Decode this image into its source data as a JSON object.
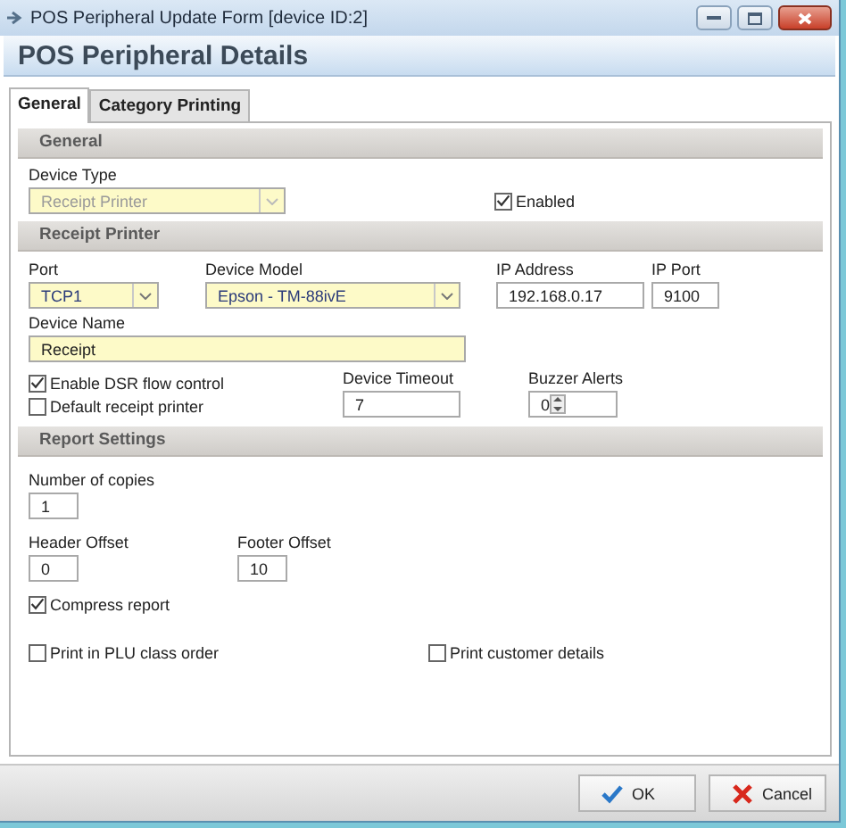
{
  "window": {
    "title": "POS Peripheral Update Form  [device ID:2]"
  },
  "header": "POS Peripheral Details",
  "tabs": [
    {
      "label": "General",
      "selected": true
    },
    {
      "label": "Category Printing",
      "selected": false
    }
  ],
  "general": {
    "title": "General",
    "device_type": {
      "label": "Device Type",
      "value": "Receipt Printer",
      "disabled": true
    },
    "enabled": {
      "label": "Enabled",
      "checked": true
    }
  },
  "receipt_printer": {
    "title": "Receipt Printer",
    "port": {
      "label": "Port",
      "value": "TCP1"
    },
    "device_model": {
      "label": "Device Model",
      "value": "Epson - TM-88ivE"
    },
    "ip_address": {
      "label": "IP Address",
      "value": "192.168.0.17"
    },
    "ip_port": {
      "label": "IP Port",
      "value": "9100"
    },
    "device_name": {
      "label": "Device Name",
      "value": "Receipt"
    },
    "dsr_flow_control": {
      "label": "Enable DSR flow control",
      "checked": true
    },
    "default_printer": {
      "label": "Default receipt printer",
      "checked": false
    },
    "device_timeout": {
      "label": "Device Timeout",
      "value": "7"
    },
    "buzzer_alerts": {
      "label": "Buzzer Alerts",
      "value": "0"
    }
  },
  "report_settings": {
    "title": "Report Settings",
    "copies": {
      "label": "Number of copies",
      "value": "1"
    },
    "header_offset": {
      "label": "Header Offset",
      "value": "0"
    },
    "footer_offset": {
      "label": "Footer Offset",
      "value": "10"
    },
    "compress": {
      "label": "Compress report",
      "checked": true
    },
    "plu_order": {
      "label": "Print in PLU class order",
      "checked": false
    },
    "customer_details": {
      "label": "Print customer details",
      "checked": false
    }
  },
  "buttons": [
    {
      "label": "OK",
      "kind": "ok"
    },
    {
      "label": "Cancel",
      "kind": "cancel"
    }
  ]
}
